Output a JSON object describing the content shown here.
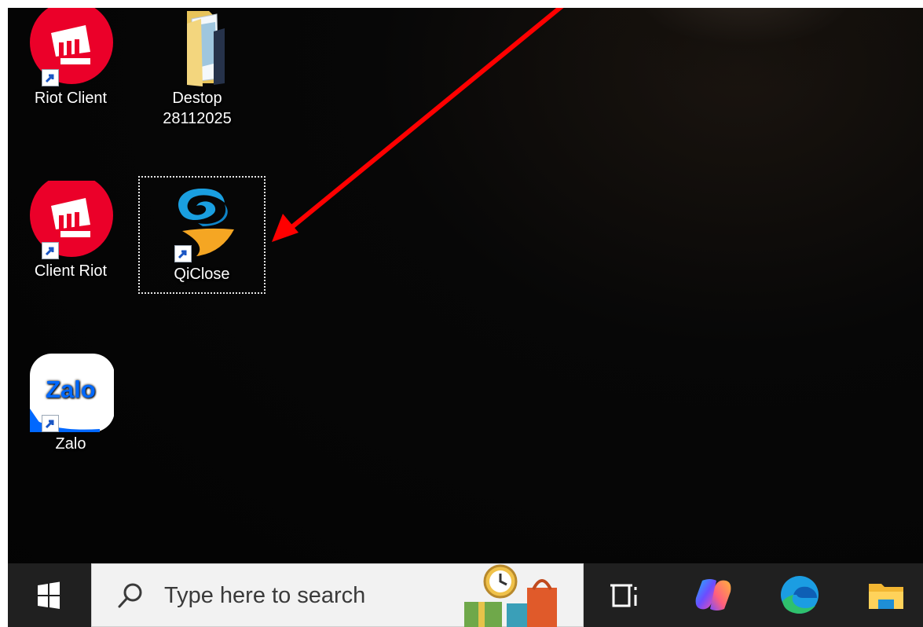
{
  "desktop": {
    "icons": [
      {
        "label_line1": "Riot Client",
        "label_line2": ""
      },
      {
        "label_line1": "Destop",
        "label_line2": "28112025"
      },
      {
        "label_line1": "Client Riot",
        "label_line2": ""
      },
      {
        "label_line1": "QiClose",
        "label_line2": ""
      },
      {
        "label_line1": "Zalo",
        "label_line2": ""
      }
    ],
    "zalo_logo_text": "Zalo",
    "selected_icon": "QiClose"
  },
  "taskbar": {
    "search_placeholder": "Type here to search",
    "start_icon": "windows-logo-icon",
    "search_icon": "magnifier-icon",
    "items": [
      "task-view-icon",
      "copilot-icon",
      "edge-icon",
      "file-explorer-icon"
    ]
  },
  "annotation": {
    "arrow_color": "#ff0000"
  },
  "colors": {
    "riot_red": "#eb0029",
    "zalo_blue": "#0068ff",
    "taskbar_bg": "#202020",
    "search_bg": "#f2f2f2"
  }
}
